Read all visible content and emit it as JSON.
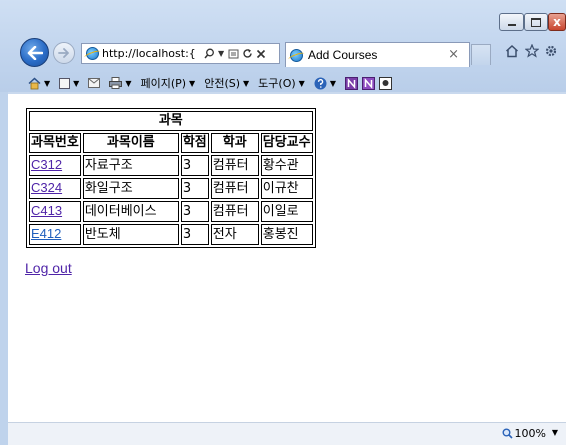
{
  "browser": {
    "address_url": "http://localhost:{",
    "tab_title": "Add Courses",
    "tab_close": "×",
    "caption_close": "x"
  },
  "command_bar": {
    "page_label": "페이지(P)",
    "safety_label": "안전(S)",
    "tools_label": "도구(O)"
  },
  "table": {
    "caption": "과목",
    "headers": [
      "과목번호",
      "과목이름",
      "학점",
      "학과",
      "담당교수"
    ],
    "rows": [
      {
        "code": "C312",
        "name": "자료구조",
        "credits": "3",
        "dept": "컴퓨터",
        "professor": "황수관"
      },
      {
        "code": "C324",
        "name": "화일구조",
        "credits": "3",
        "dept": "컴퓨터",
        "professor": "이규찬"
      },
      {
        "code": "C413",
        "name": "데이터베이스",
        "credits": "3",
        "dept": "컴퓨터",
        "professor": "이일로"
      },
      {
        "code": "E412",
        "name": "반도체",
        "credits": "3",
        "dept": "전자",
        "professor": "홍봉진"
      }
    ]
  },
  "logout_label": "Log out",
  "status": {
    "zoom": "100%"
  },
  "colors": {
    "visited_link": "#4f24a8",
    "link": "#1f5fbd"
  }
}
